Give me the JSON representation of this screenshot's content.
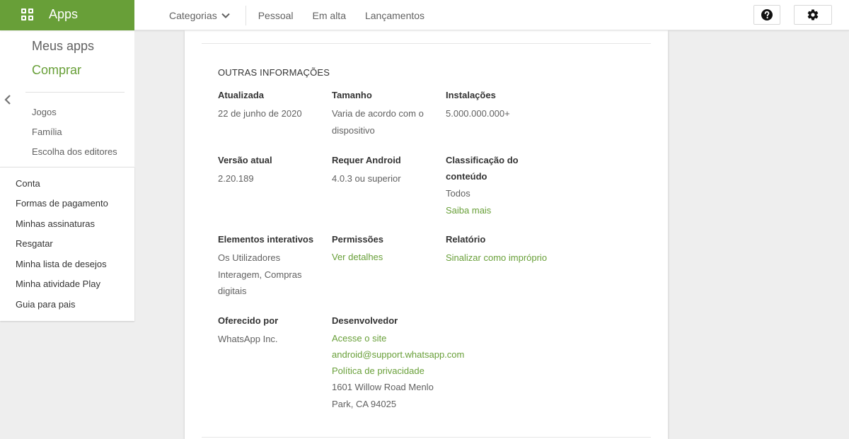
{
  "header": {
    "brand": "Apps",
    "nav": {
      "categories": "Categorias",
      "personal": "Pessoal",
      "trending": "Em alta",
      "releases": "Lançamentos"
    },
    "icons": {
      "apps": "apps-grid-icon",
      "dropdown": "chevron-down-icon",
      "help": "help-icon",
      "settings": "gear-icon"
    }
  },
  "sidebar": {
    "primary": [
      "Meus apps",
      "Comprar"
    ],
    "sub": [
      "Jogos",
      "Família",
      "Escolha dos editores"
    ],
    "account": [
      "Conta",
      "Formas de pagamento",
      "Minhas assinaturas",
      "Resgatar",
      "Minha lista de desejos",
      "Minha atividade Play",
      "Guia para pais"
    ]
  },
  "info": {
    "section_title": "OUTRAS INFORMAÇÕES",
    "updated_label": "Atualizada",
    "updated_value": "22 de junho de 2020",
    "size_label": "Tamanho",
    "size_value_1": "Varia de acordo com o",
    "size_value_2": "dispositivo",
    "installs_label": "Instalações",
    "installs_value": "5.000.000.000+",
    "version_label": "Versão atual",
    "version_value": "2.20.189",
    "android_label": "Requer Android",
    "android_value": "4.0.3 ou superior",
    "rating_label_1": "Classificação do",
    "rating_label_2": "conteúdo",
    "rating_value": "Todos",
    "rating_link": "Saiba mais",
    "interactive_label": "Elementos interativos",
    "interactive_value_1": "Os Utilizadores",
    "interactive_value_2": "Interagem, Compras",
    "interactive_value_3": "digitais",
    "permissions_label": "Permissões",
    "permissions_link": "Ver detalhes",
    "report_label": "Relatório",
    "report_link": "Sinalizar como impróprio",
    "offered_label": "Oferecido por",
    "offered_value": "WhatsApp Inc.",
    "developer_label": "Desenvolvedor",
    "developer_site": "Acesse o site",
    "developer_email": "android@support.whatsapp.com",
    "developer_privacy": "Política de privacidade",
    "developer_address_1": "1601 Willow Road Menlo",
    "developer_address_2": "Park, CA 94025"
  },
  "colors": {
    "accent_green": "#689f38",
    "background": "#eeeeee"
  }
}
